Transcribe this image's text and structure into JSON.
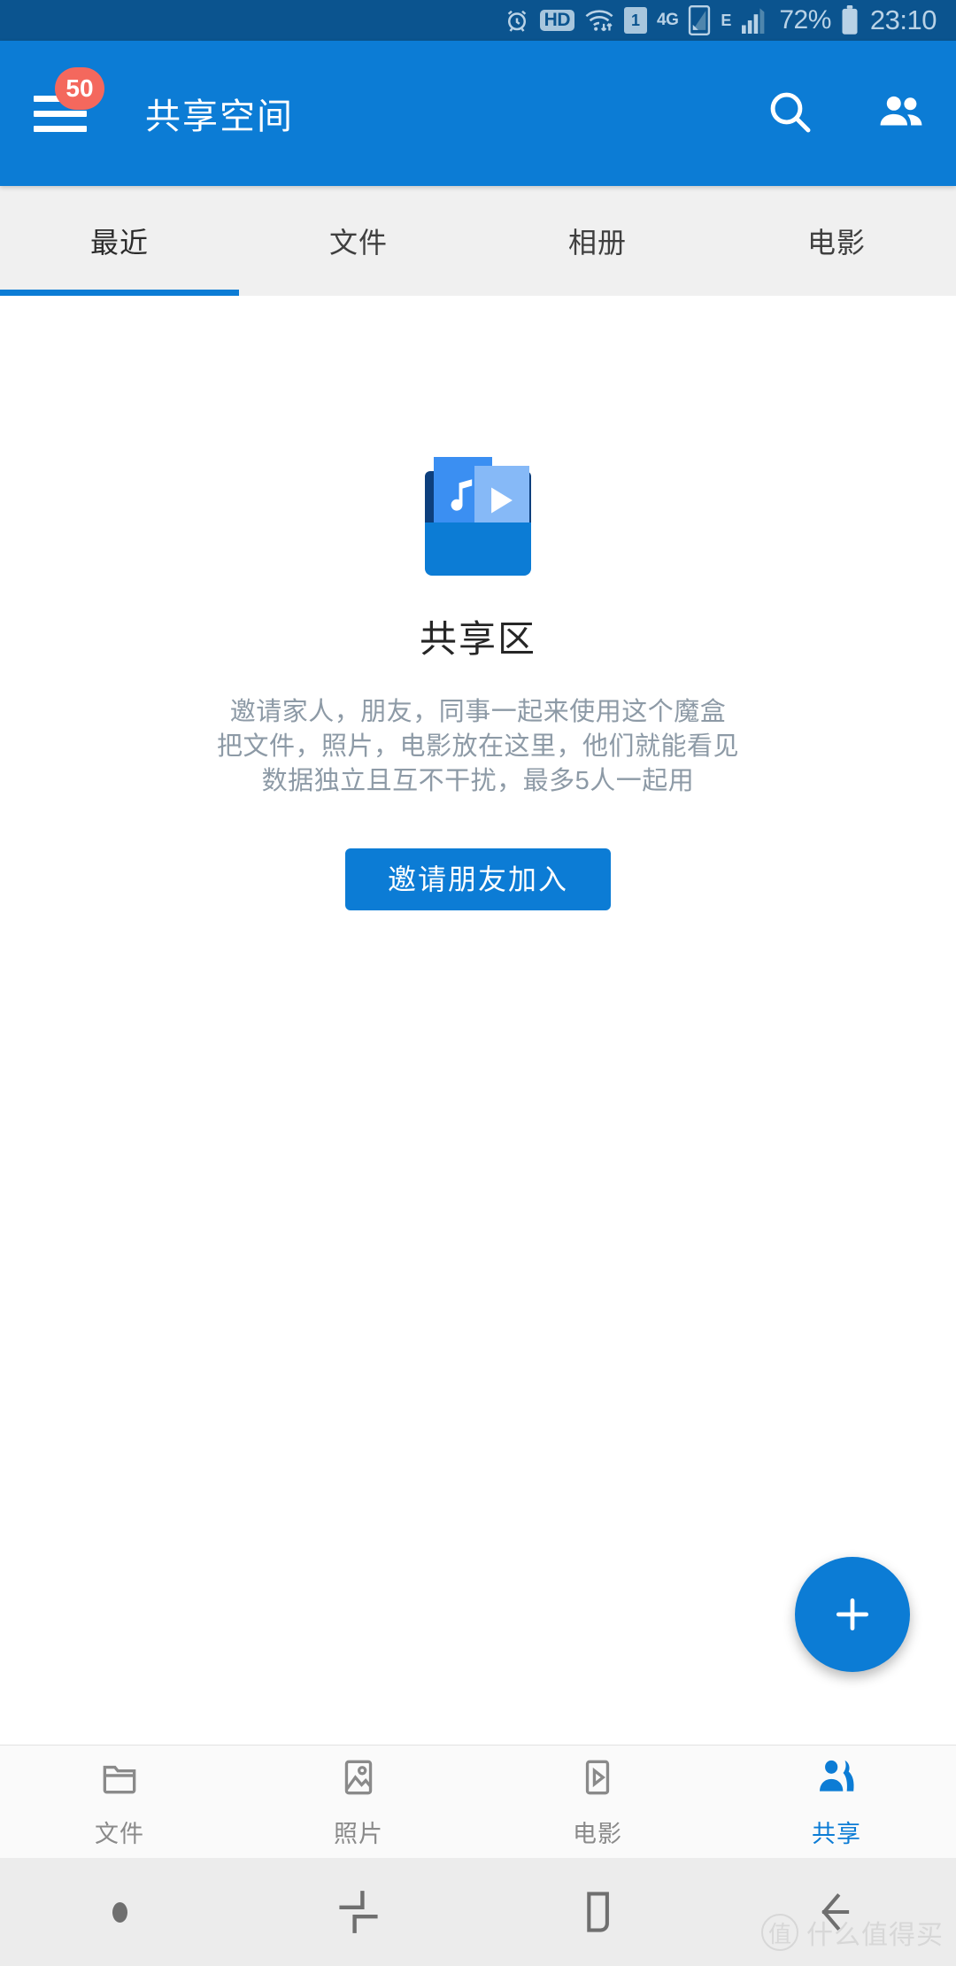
{
  "status_bar": {
    "background": "#0b548f",
    "icons": [
      "alarm-icon",
      "hd-icon",
      "wifi-icon",
      "sim1-icon",
      "4g-icon",
      "sim-signal-icon",
      "edge-icon",
      "cellular-signal-icon"
    ],
    "hd_label": "HD",
    "sim_label": "1",
    "network_label": "4G",
    "edge_label": "E",
    "battery_percent": "72%",
    "time": "23:10"
  },
  "app_bar": {
    "background": "#0c7cd5",
    "menu_badge": "50",
    "badge_color": "#f4685d",
    "title": "共享空间",
    "actions": [
      {
        "name": "search-icon",
        "label": "搜索"
      },
      {
        "name": "people-icon",
        "label": "成员"
      }
    ]
  },
  "tabs": {
    "active_index": 0,
    "items": [
      {
        "label": "最近"
      },
      {
        "label": "文件"
      },
      {
        "label": "相册"
      },
      {
        "label": "电影"
      }
    ]
  },
  "empty_state": {
    "illustration": "shared-folder-media-icon",
    "title": "共享区",
    "description_lines": [
      "邀请家人，朋友，同事一起来使用这个魔盒",
      "把文件，照片，电影放在这里，他们就能看见",
      "数据独立且互不干扰，最多5人一起用"
    ],
    "cta_label": "邀请朋友加入"
  },
  "fab": {
    "label": "+",
    "color": "#0c7cd5"
  },
  "bottom_nav": {
    "active_index": 3,
    "accent": "#0c7cd5",
    "items": [
      {
        "label": "文件",
        "icon": "folder-icon"
      },
      {
        "label": "照片",
        "icon": "photo-icon"
      },
      {
        "label": "电影",
        "icon": "movie-icon"
      },
      {
        "label": "共享",
        "icon": "people-icon"
      }
    ]
  },
  "system_nav": {
    "items": [
      {
        "name": "indicator-dot",
        "label": ""
      },
      {
        "name": "recents-button",
        "label": ""
      },
      {
        "name": "home-button",
        "label": ""
      },
      {
        "name": "back-button",
        "label": ""
      }
    ]
  },
  "watermark": {
    "mark": "值",
    "text": "什么值得买"
  }
}
